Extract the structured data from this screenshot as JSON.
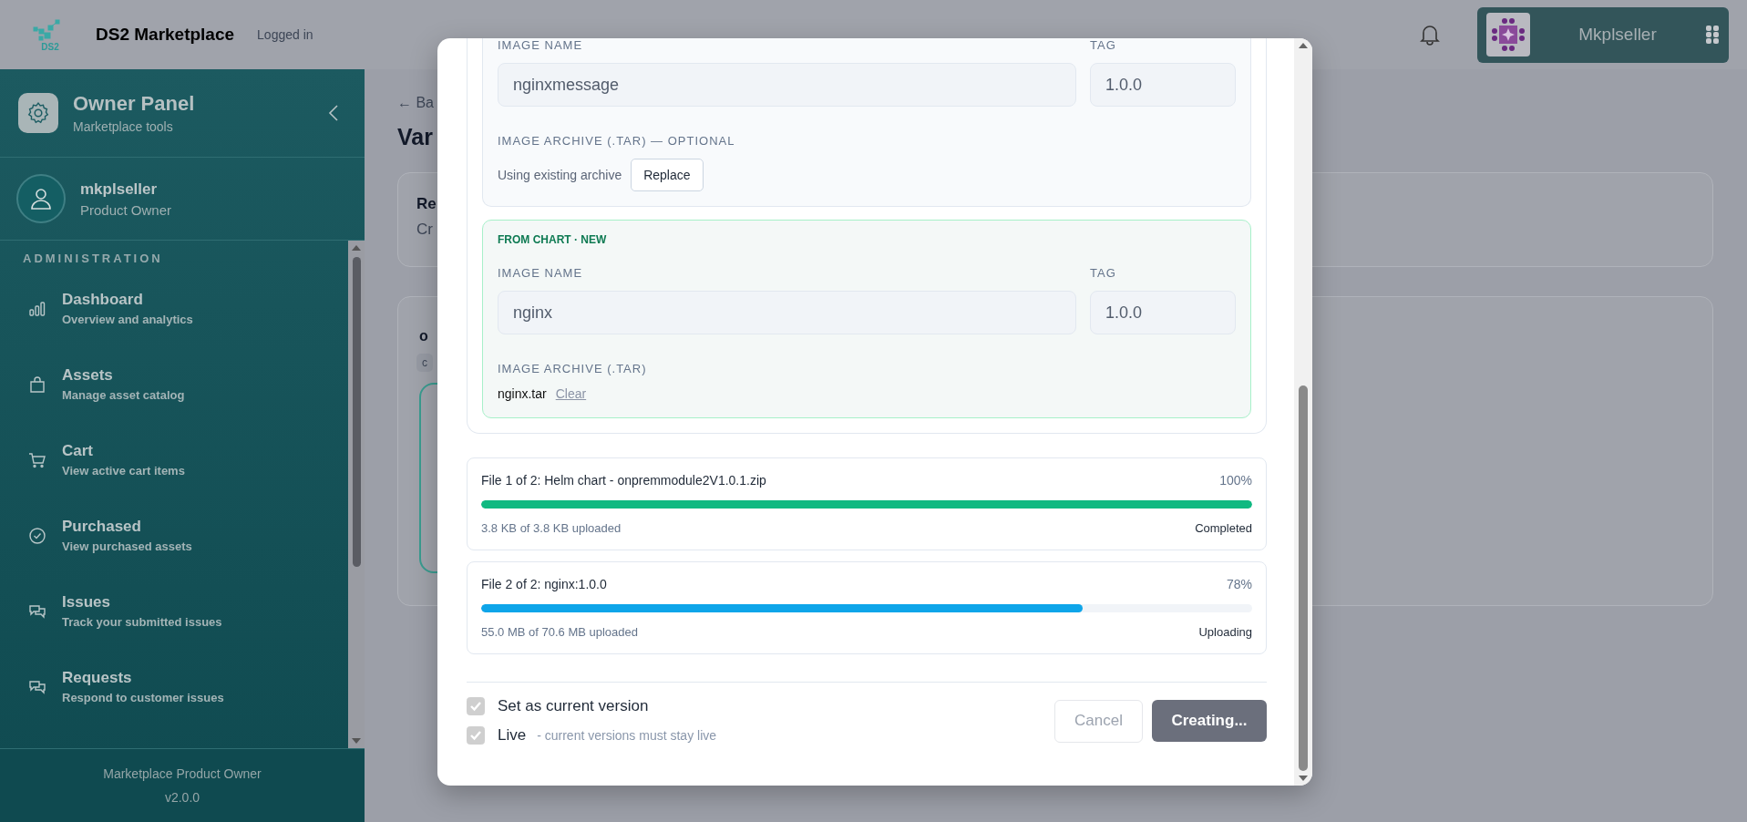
{
  "header": {
    "logo_text": "DS2",
    "title": "DS2 Marketplace",
    "status": "Logged in",
    "user": "Mkplseller"
  },
  "sidebar": {
    "title": "Owner Panel",
    "subtitle": "Marketplace tools",
    "user_name": "mkplseller",
    "user_role": "Product Owner",
    "section": "ADMINISTRATION",
    "items": [
      {
        "label": "Dashboard",
        "description": "Overview and analytics"
      },
      {
        "label": "Assets",
        "description": "Manage asset catalog"
      },
      {
        "label": "Cart",
        "description": "View active cart items"
      },
      {
        "label": "Purchased",
        "description": "View purchased assets"
      },
      {
        "label": "Issues",
        "description": "Track your submitted issues"
      },
      {
        "label": "Requests",
        "description": "Respond to customer issues"
      }
    ],
    "footer": [
      "Marketplace Product Owner",
      "v2.0.0"
    ]
  },
  "page": {
    "back_link": "← Ba",
    "heading": "Var",
    "card_1": {
      "title": "Re",
      "text": "Cr"
    },
    "card_2": {
      "title": "o",
      "chip": "c"
    }
  },
  "modal": {
    "images": [
      {
        "kind": "existing",
        "image_name_label": "IMAGE NAME",
        "image_name": "nginxmessage",
        "tag_label": "TAG",
        "tag": "1.0.0",
        "archive_label": "IMAGE ARCHIVE (.TAR) — OPTIONAL",
        "archive_text": "Using existing archive",
        "action": "Replace"
      },
      {
        "kind": "new",
        "badge": "FROM CHART · NEW",
        "image_name_label": "IMAGE NAME",
        "image_name": "nginx",
        "tag_label": "TAG",
        "tag": "1.0.0",
        "archive_label": "IMAGE ARCHIVE (.TAR)",
        "archive_text": "nginx.tar",
        "action": "Clear"
      }
    ],
    "uploads": [
      {
        "title": "File 1 of 2: Helm chart - onpremmodule2V1.0.1.zip",
        "percent": "100%",
        "level": 1.0,
        "color": "#10b981",
        "detail": "3.8 KB of 3.8 KB uploaded",
        "status": "Completed"
      },
      {
        "title": "File 2 of 2: nginx:1.0.0",
        "percent": "78%",
        "level": 0.78,
        "color": "#0ea5e9",
        "detail": "55.0 MB of 70.6 MB uploaded",
        "status": "Uploading"
      }
    ],
    "options": [
      {
        "label": "Set as current version",
        "checked": true,
        "disabled": true
      },
      {
        "label": "Live",
        "checked": true,
        "disabled": true,
        "note": "- current versions must stay live"
      }
    ],
    "cancel": "Cancel",
    "submit": "Creating..."
  }
}
